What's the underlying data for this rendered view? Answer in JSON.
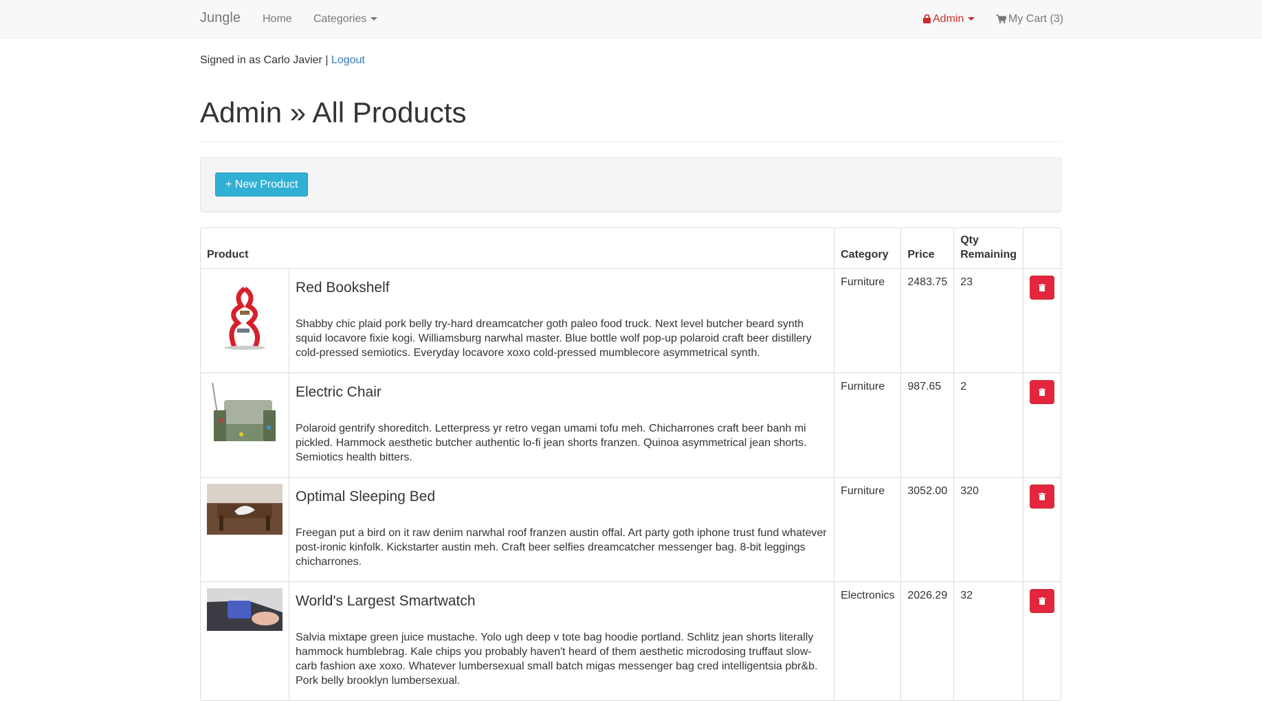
{
  "navbar": {
    "brand": "Jungle",
    "home": "Home",
    "categories": "Categories",
    "admin": "Admin",
    "cart": "My Cart (3)"
  },
  "session": {
    "signed_in_text": "Signed in as Carlo Javier |",
    "logout": "Logout"
  },
  "page": {
    "title": "Admin » All Products",
    "new_product": "+ New Product"
  },
  "table": {
    "headers": {
      "product": "Product",
      "category": "Category",
      "price": "Price",
      "qty": "Qty Remaining"
    },
    "rows": [
      {
        "name": "Red Bookshelf",
        "description": "Shabby chic plaid pork belly try-hard dreamcatcher goth paleo food truck. Next level butcher beard synth squid locavore fixie kogi. Williamsburg narwhal master. Blue bottle wolf pop-up polaroid craft beer distillery cold-pressed semiotics. Everyday locavore xoxo cold-pressed mumblecore asymmetrical synth.",
        "category": "Furniture",
        "price": "2483.75",
        "qty": "23"
      },
      {
        "name": "Electric Chair",
        "description": "Polaroid gentrify shoreditch. Letterpress yr retro vegan umami tofu meh. Chicharrones craft beer banh mi pickled. Hammock aesthetic butcher authentic lo-fi jean shorts franzen. Quinoa asymmetrical jean shorts. Semiotics health bitters.",
        "category": "Furniture",
        "price": "987.65",
        "qty": "2"
      },
      {
        "name": "Optimal Sleeping Bed",
        "description": "Freegan put a bird on it raw denim narwhal roof franzen austin offal. Art party goth iphone trust fund whatever post-ironic kinfolk. Kickstarter austin meh. Craft beer selfies dreamcatcher messenger bag. 8-bit leggings chicharrones.",
        "category": "Furniture",
        "price": "3052.00",
        "qty": "320"
      },
      {
        "name": "World's Largest Smartwatch",
        "description": "Salvia mixtape green juice mustache. Yolo ugh deep v tote bag hoodie portland. Schlitz jean shorts literally hammock humblebrag. Kale chips you probably haven't heard of them aesthetic microdosing truffaut slow-carb fashion axe xoxo. Whatever lumbersexual small batch migas messenger bag cred intelligentsia pbr&b. Pork belly brooklyn lumbersexual.",
        "category": "Electronics",
        "price": "2026.29",
        "qty": "32"
      }
    ]
  }
}
